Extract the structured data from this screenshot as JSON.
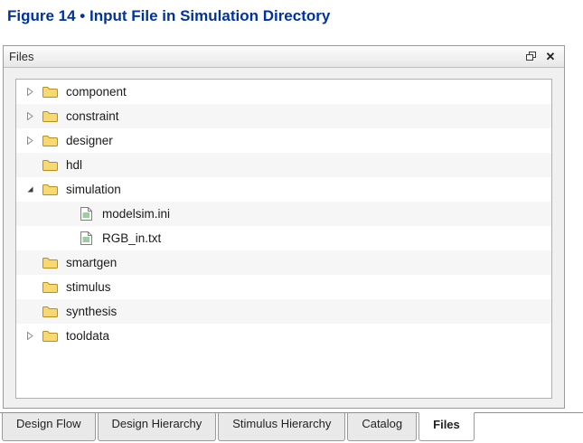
{
  "caption": {
    "text": "Figure 14 • Input File in Simulation Directory"
  },
  "panel": {
    "title": "Files",
    "close_glyph": "✕",
    "float_icon": "float-window-icon"
  },
  "tree": {
    "items": [
      {
        "label": "component",
        "type": "folder",
        "expander": "collapsed",
        "level": 0
      },
      {
        "label": "constraint",
        "type": "folder",
        "expander": "collapsed",
        "level": 0
      },
      {
        "label": "designer",
        "type": "folder",
        "expander": "collapsed",
        "level": 0
      },
      {
        "label": "hdl",
        "type": "folder",
        "expander": "none",
        "level": 0
      },
      {
        "label": "simulation",
        "type": "folder",
        "expander": "expanded",
        "level": 0
      },
      {
        "label": "modelsim.ini",
        "type": "file",
        "expander": "none",
        "level": 1
      },
      {
        "label": "RGB_in.txt",
        "type": "file",
        "expander": "none",
        "level": 1
      },
      {
        "label": "smartgen",
        "type": "folder",
        "expander": "none",
        "level": 0
      },
      {
        "label": "stimulus",
        "type": "folder",
        "expander": "none",
        "level": 0
      },
      {
        "label": "synthesis",
        "type": "folder",
        "expander": "none",
        "level": 0
      },
      {
        "label": "tooldata",
        "type": "folder",
        "expander": "collapsed",
        "level": 0
      }
    ]
  },
  "tabs": [
    {
      "label": "Design Flow",
      "active": false
    },
    {
      "label": "Design Hierarchy",
      "active": false
    },
    {
      "label": "Stimulus Hierarchy",
      "active": false
    },
    {
      "label": "Catalog",
      "active": false
    },
    {
      "label": "Files",
      "active": true
    }
  ],
  "colors": {
    "caption_blue": "#0033A0",
    "folder_yellow": "#F8D870",
    "folder_outline": "#B8901F",
    "file_line_green": "#3C9A3C"
  }
}
